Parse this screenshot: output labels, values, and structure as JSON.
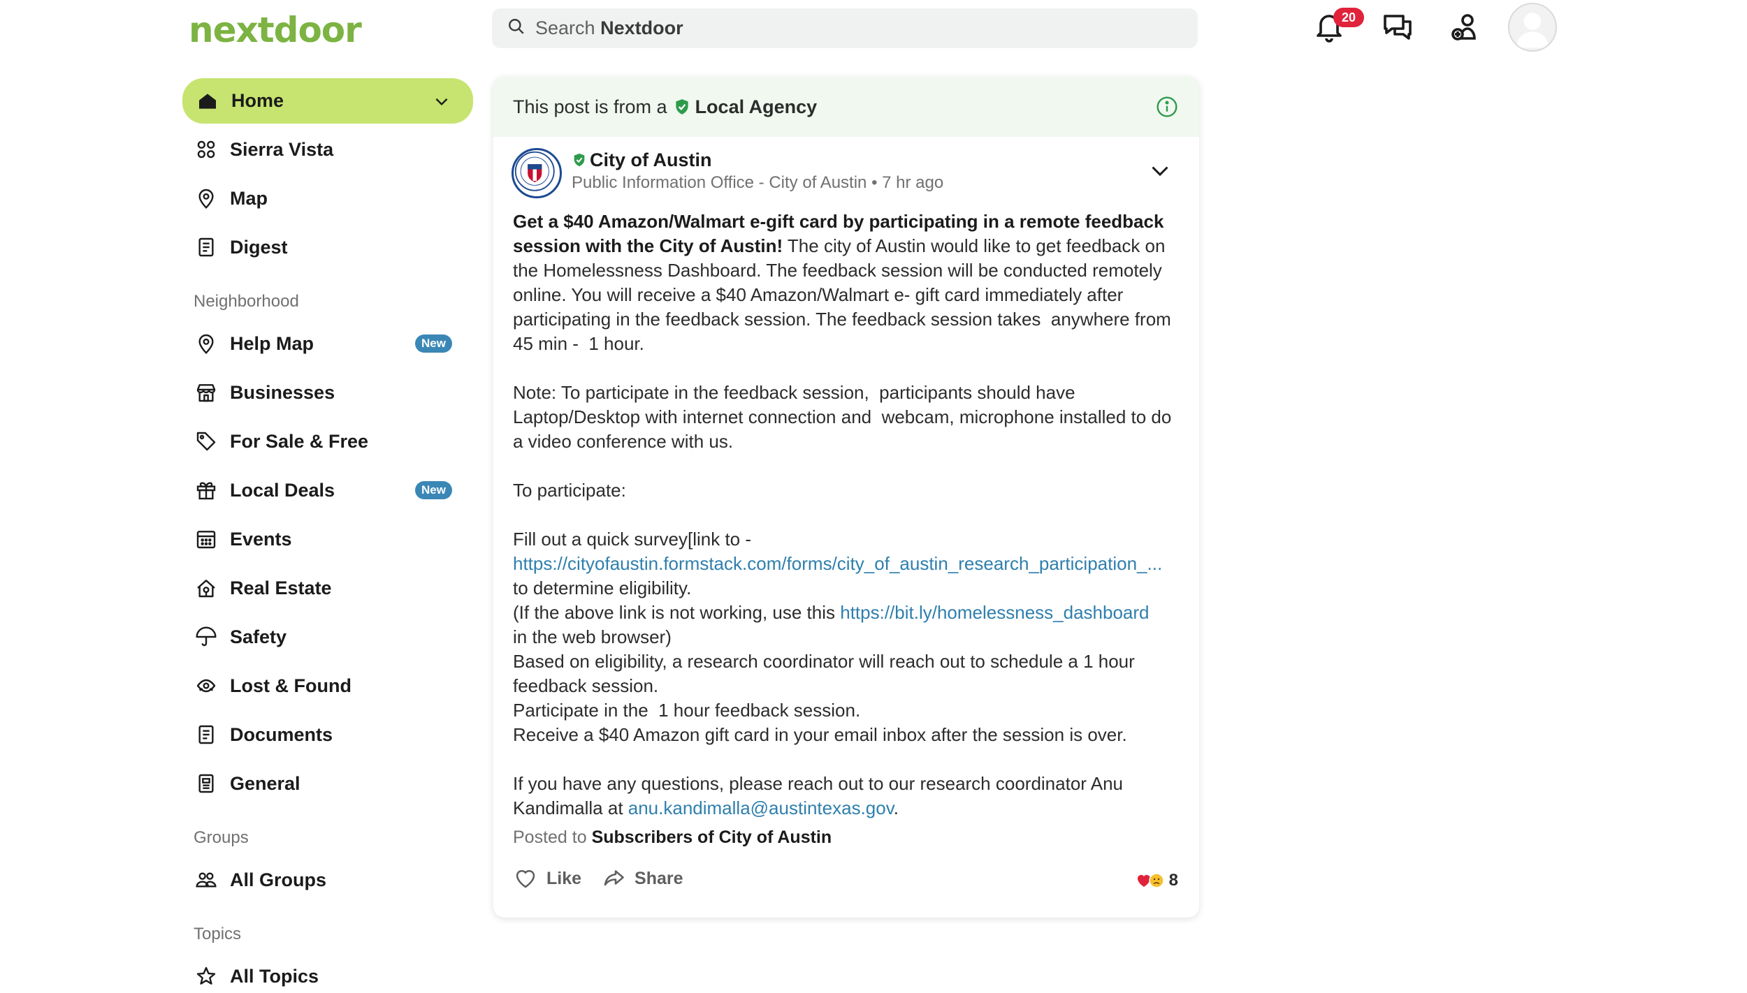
{
  "header": {
    "logo": "nextdoor",
    "search_prefix": "Search",
    "search_brand": "Nextdoor",
    "notification_count": "20"
  },
  "sidebar": {
    "home": "Home",
    "items_top": [
      {
        "label": "Sierra Vista",
        "icon": "neighborhood-icon"
      },
      {
        "label": "Map",
        "icon": "map-pin-icon"
      },
      {
        "label": "Digest",
        "icon": "digest-icon"
      }
    ],
    "neighborhood_title": "Neighborhood",
    "items_neighborhood": [
      {
        "label": "Help Map",
        "icon": "map-pin-icon",
        "badge": "New"
      },
      {
        "label": "Businesses",
        "icon": "storefront-icon"
      },
      {
        "label": "For Sale & Free",
        "icon": "tag-icon"
      },
      {
        "label": "Local Deals",
        "icon": "gift-icon",
        "badge": "New"
      },
      {
        "label": "Events",
        "icon": "calendar-icon"
      },
      {
        "label": "Real Estate",
        "icon": "house-icon"
      },
      {
        "label": "Safety",
        "icon": "umbrella-icon"
      },
      {
        "label": "Lost & Found",
        "icon": "lost-found-icon"
      },
      {
        "label": "Documents",
        "icon": "document-icon"
      },
      {
        "label": "General",
        "icon": "general-icon"
      }
    ],
    "groups_title": "Groups",
    "all_groups": "All Groups",
    "topics_title": "Topics",
    "all_topics": "All Topics"
  },
  "post": {
    "agency_prefix": "This post is from a",
    "agency_type": "Local Agency",
    "author": "City of Austin",
    "meta": "Public Information Office - City of Austin • 7 hr ago",
    "headline": "Get a $40 Amazon/Walmart e-gift card by participating in a remote feedback session with the City of Austin!",
    "intro": " The city of Austin would like to get feedback on the Homelessness Dashboard. The feedback session will be conducted remotely online. You will receive a $40 Amazon/Walmart e- gift card immediately after participating in the feedback session. The feedback session takes  anywhere from 45 min -  1 hour.",
    "note": "Note: To participate in the feedback session,  participants should have Laptop/Desktop with internet connection and  webcam, microphone installed to do a video conference with us.",
    "to_participate": "To participate:",
    "survey_line": "Fill out a quick survey[link to -",
    "survey_link": "https://cityofaustin.formstack.com/forms/city_of_austin_research_participation_...",
    "survey_after": "to determine eligibility.",
    "alt_prefix": "(If the above link is not working, use this ",
    "alt_link": "https://bit.ly/homelessness_dashboard",
    "alt_after": "in the web browser)",
    "step2": "Based on eligibility, a research coordinator will reach out to schedule a 1 hour feedback session.",
    "step3": "Participate in the  1 hour feedback session.",
    "step4": "Receive a $40 Amazon gift card in your email inbox after the session is over.",
    "questions": "If you have any questions, please reach out to our research coordinator Anu Kandimalla at ",
    "email": "anu.kandimalla@austintexas.gov",
    "questions_end": ".",
    "posted_to_prefix": "Posted to",
    "posted_to": "Subscribers of City of Austin",
    "like": "Like",
    "share": "Share",
    "reaction_count": "8"
  },
  "colors": {
    "brand_green": "#7cb342",
    "home_highlight": "#c6e46f",
    "link_blue": "#2f7fad",
    "badge_red": "#e0233b",
    "new_pill": "#3a87b6",
    "verified_green": "#2e9b4b"
  }
}
